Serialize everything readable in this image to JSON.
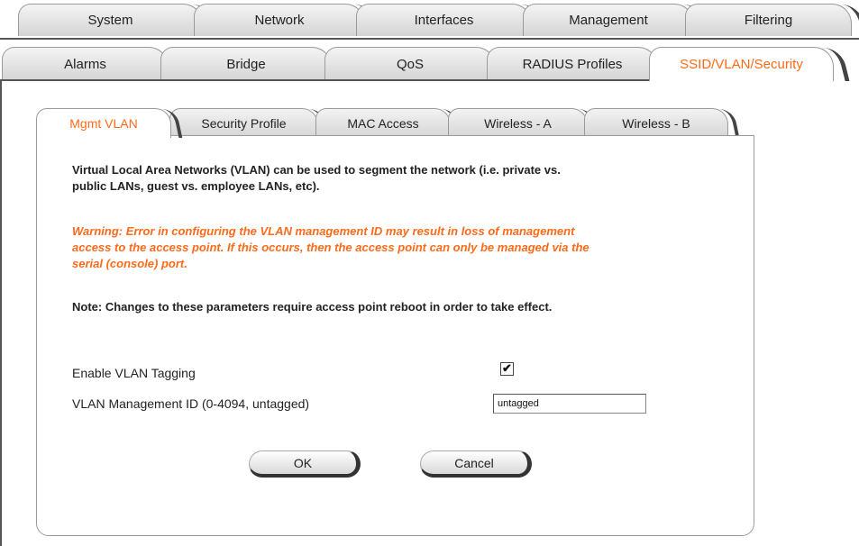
{
  "top_tabs": [
    "System",
    "Network",
    "Interfaces",
    "Management",
    "Filtering"
  ],
  "second_tabs": [
    "Alarms",
    "Bridge",
    "QoS",
    "RADIUS Profiles",
    "SSID/VLAN/Security"
  ],
  "second_tabs_active": "SSID/VLAN/Security",
  "sub_tabs": [
    "Mgmt VLAN",
    "Security Profile",
    "MAC Access",
    "Wireless - A",
    "Wireless - B"
  ],
  "sub_tabs_active": "Mgmt VLAN",
  "intro_line1": "Virtual Local Area Networks (VLAN) can be used to segment the network (i.e. private vs.",
  "intro_line2": "public LANs, guest vs. employee LANs, etc).",
  "warning_line1": "Warning: Error in configuring the VLAN management ID may result in loss of management",
  "warning_line2": "access to the access point. If this occurs, then the access point can only be managed via the",
  "warning_line3": "serial (console) port.",
  "note": "Note: Changes to these parameters require access point reboot in order to take effect.",
  "form": {
    "enable_tagging_label": "Enable VLAN Tagging",
    "enable_tagging_checked": true,
    "checkmark": "✔",
    "mgmt_id_label": "VLAN Management ID (0-4094, untagged)",
    "mgmt_id_value": "untagged"
  },
  "buttons": {
    "ok": "OK",
    "cancel": "Cancel"
  },
  "colors": {
    "accent": "#ff6a1a",
    "text": "#222222"
  }
}
